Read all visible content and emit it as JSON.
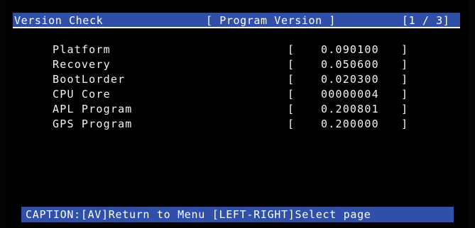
{
  "header": {
    "title": "Version Check",
    "section": "[ Program Version ]",
    "page": "[1 / 3]"
  },
  "rows": [
    {
      "label": "Platform",
      "open": "[",
      "value": "0.090100",
      "close": "]"
    },
    {
      "label": "Recovery",
      "open": "[",
      "value": "0.050600",
      "close": "]"
    },
    {
      "label": "BootLorder",
      "open": "[",
      "value": "0.020300",
      "close": "]"
    },
    {
      "label": "CPU Core",
      "open": "[",
      "value": "00000004",
      "close": "]"
    },
    {
      "label": "APL Program",
      "open": "[",
      "value": "0.200801",
      "close": "]"
    },
    {
      "label": "GPS Program",
      "open": "[",
      "value": "0.200000",
      "close": "]"
    }
  ],
  "caption": {
    "text": "CAPTION:[AV]Return to Menu [LEFT-RIGHT]Select page"
  },
  "colors": {
    "bar": "#2f4fa8",
    "background": "#000000",
    "text": "#ffffff"
  }
}
